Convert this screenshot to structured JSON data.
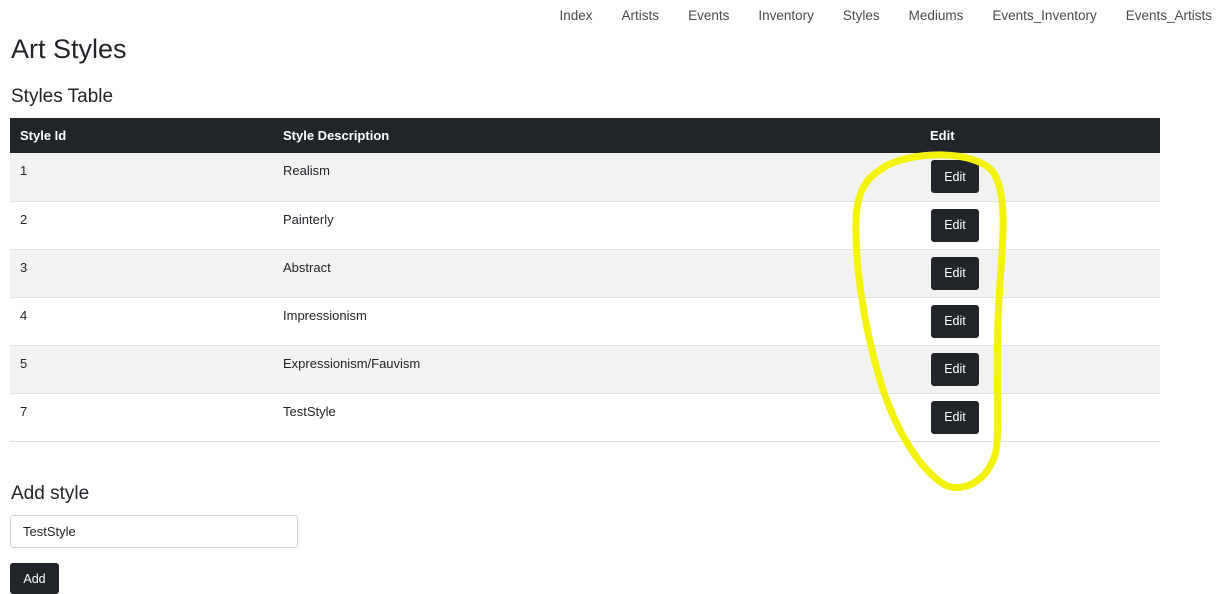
{
  "nav": {
    "items": [
      "Index",
      "Artists",
      "Events",
      "Inventory",
      "Styles",
      "Mediums",
      "Events_Inventory",
      "Events_Artists"
    ]
  },
  "page": {
    "title": "Art Styles"
  },
  "table": {
    "title": "Styles Table",
    "headers": {
      "id": "Style Id",
      "description": "Style Description",
      "edit": "Edit"
    },
    "rows": [
      {
        "id": "1",
        "description": "Realism",
        "edit_label": "Edit"
      },
      {
        "id": "2",
        "description": "Painterly",
        "edit_label": "Edit"
      },
      {
        "id": "3",
        "description": "Abstract",
        "edit_label": "Edit"
      },
      {
        "id": "4",
        "description": "Impressionism",
        "edit_label": "Edit"
      },
      {
        "id": "5",
        "description": "Expressionism/Fauvism",
        "edit_label": "Edit"
      },
      {
        "id": "7",
        "description": "TestStyle",
        "edit_label": "Edit"
      }
    ]
  },
  "add_form": {
    "title": "Add style",
    "input_value": "TestStyle",
    "button_label": "Add"
  },
  "annotation": {
    "color": "#f5f20a"
  }
}
